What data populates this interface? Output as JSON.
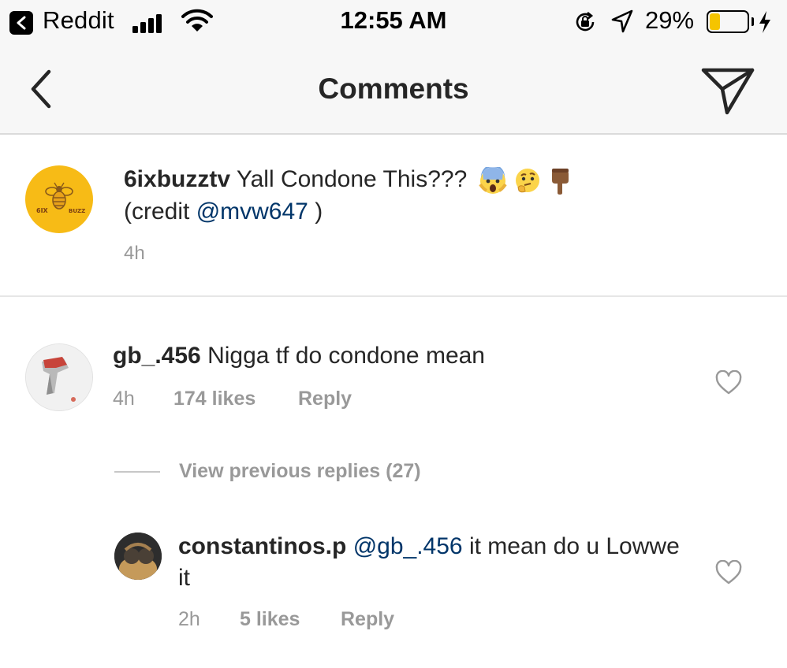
{
  "status_bar": {
    "back_app": "Reddit",
    "time": "12:55 AM",
    "battery_percent": "29%",
    "battery_level": 0.29,
    "battery_color": "#f5c400",
    "icons": [
      "back-chevron-icon",
      "signal-icon",
      "wifi-icon",
      "orientation-lock-icon",
      "location-arrow-icon",
      "battery-icon",
      "charging-bolt-icon"
    ]
  },
  "nav": {
    "title": "Comments",
    "back_icon": "chevron-left-icon",
    "send_icon": "paper-plane-icon"
  },
  "post": {
    "username": "6ixbuzztv",
    "caption": "Yall Condone This???",
    "emojis": [
      "screaming-face-emoji",
      "thinking-face-emoji",
      "pointing-down-emoji"
    ],
    "credit_prefix": "(credit ",
    "credit_mention": "@mvw647",
    "credit_suffix": " )",
    "time": "4h",
    "avatar_icon": "6ix-buzz-bee-logo",
    "avatar_logo_text": "6IX BUZZ"
  },
  "comments": [
    {
      "username": "gb_.456",
      "text": "Nigga tf do condone mean",
      "time": "4h",
      "likes": "174 likes",
      "reply_label": "Reply"
    }
  ],
  "replies_toggle": "View previous replies (27)",
  "reply": {
    "username": "constantinos.p",
    "mention": "@gb_.456",
    "text": "it mean do u Lowwe it",
    "time": "2h",
    "likes": "5 likes",
    "reply_label": "Reply"
  },
  "colors": {
    "mention": "#003569",
    "meta": "#999999",
    "bar_background": "#f7f7f7"
  }
}
